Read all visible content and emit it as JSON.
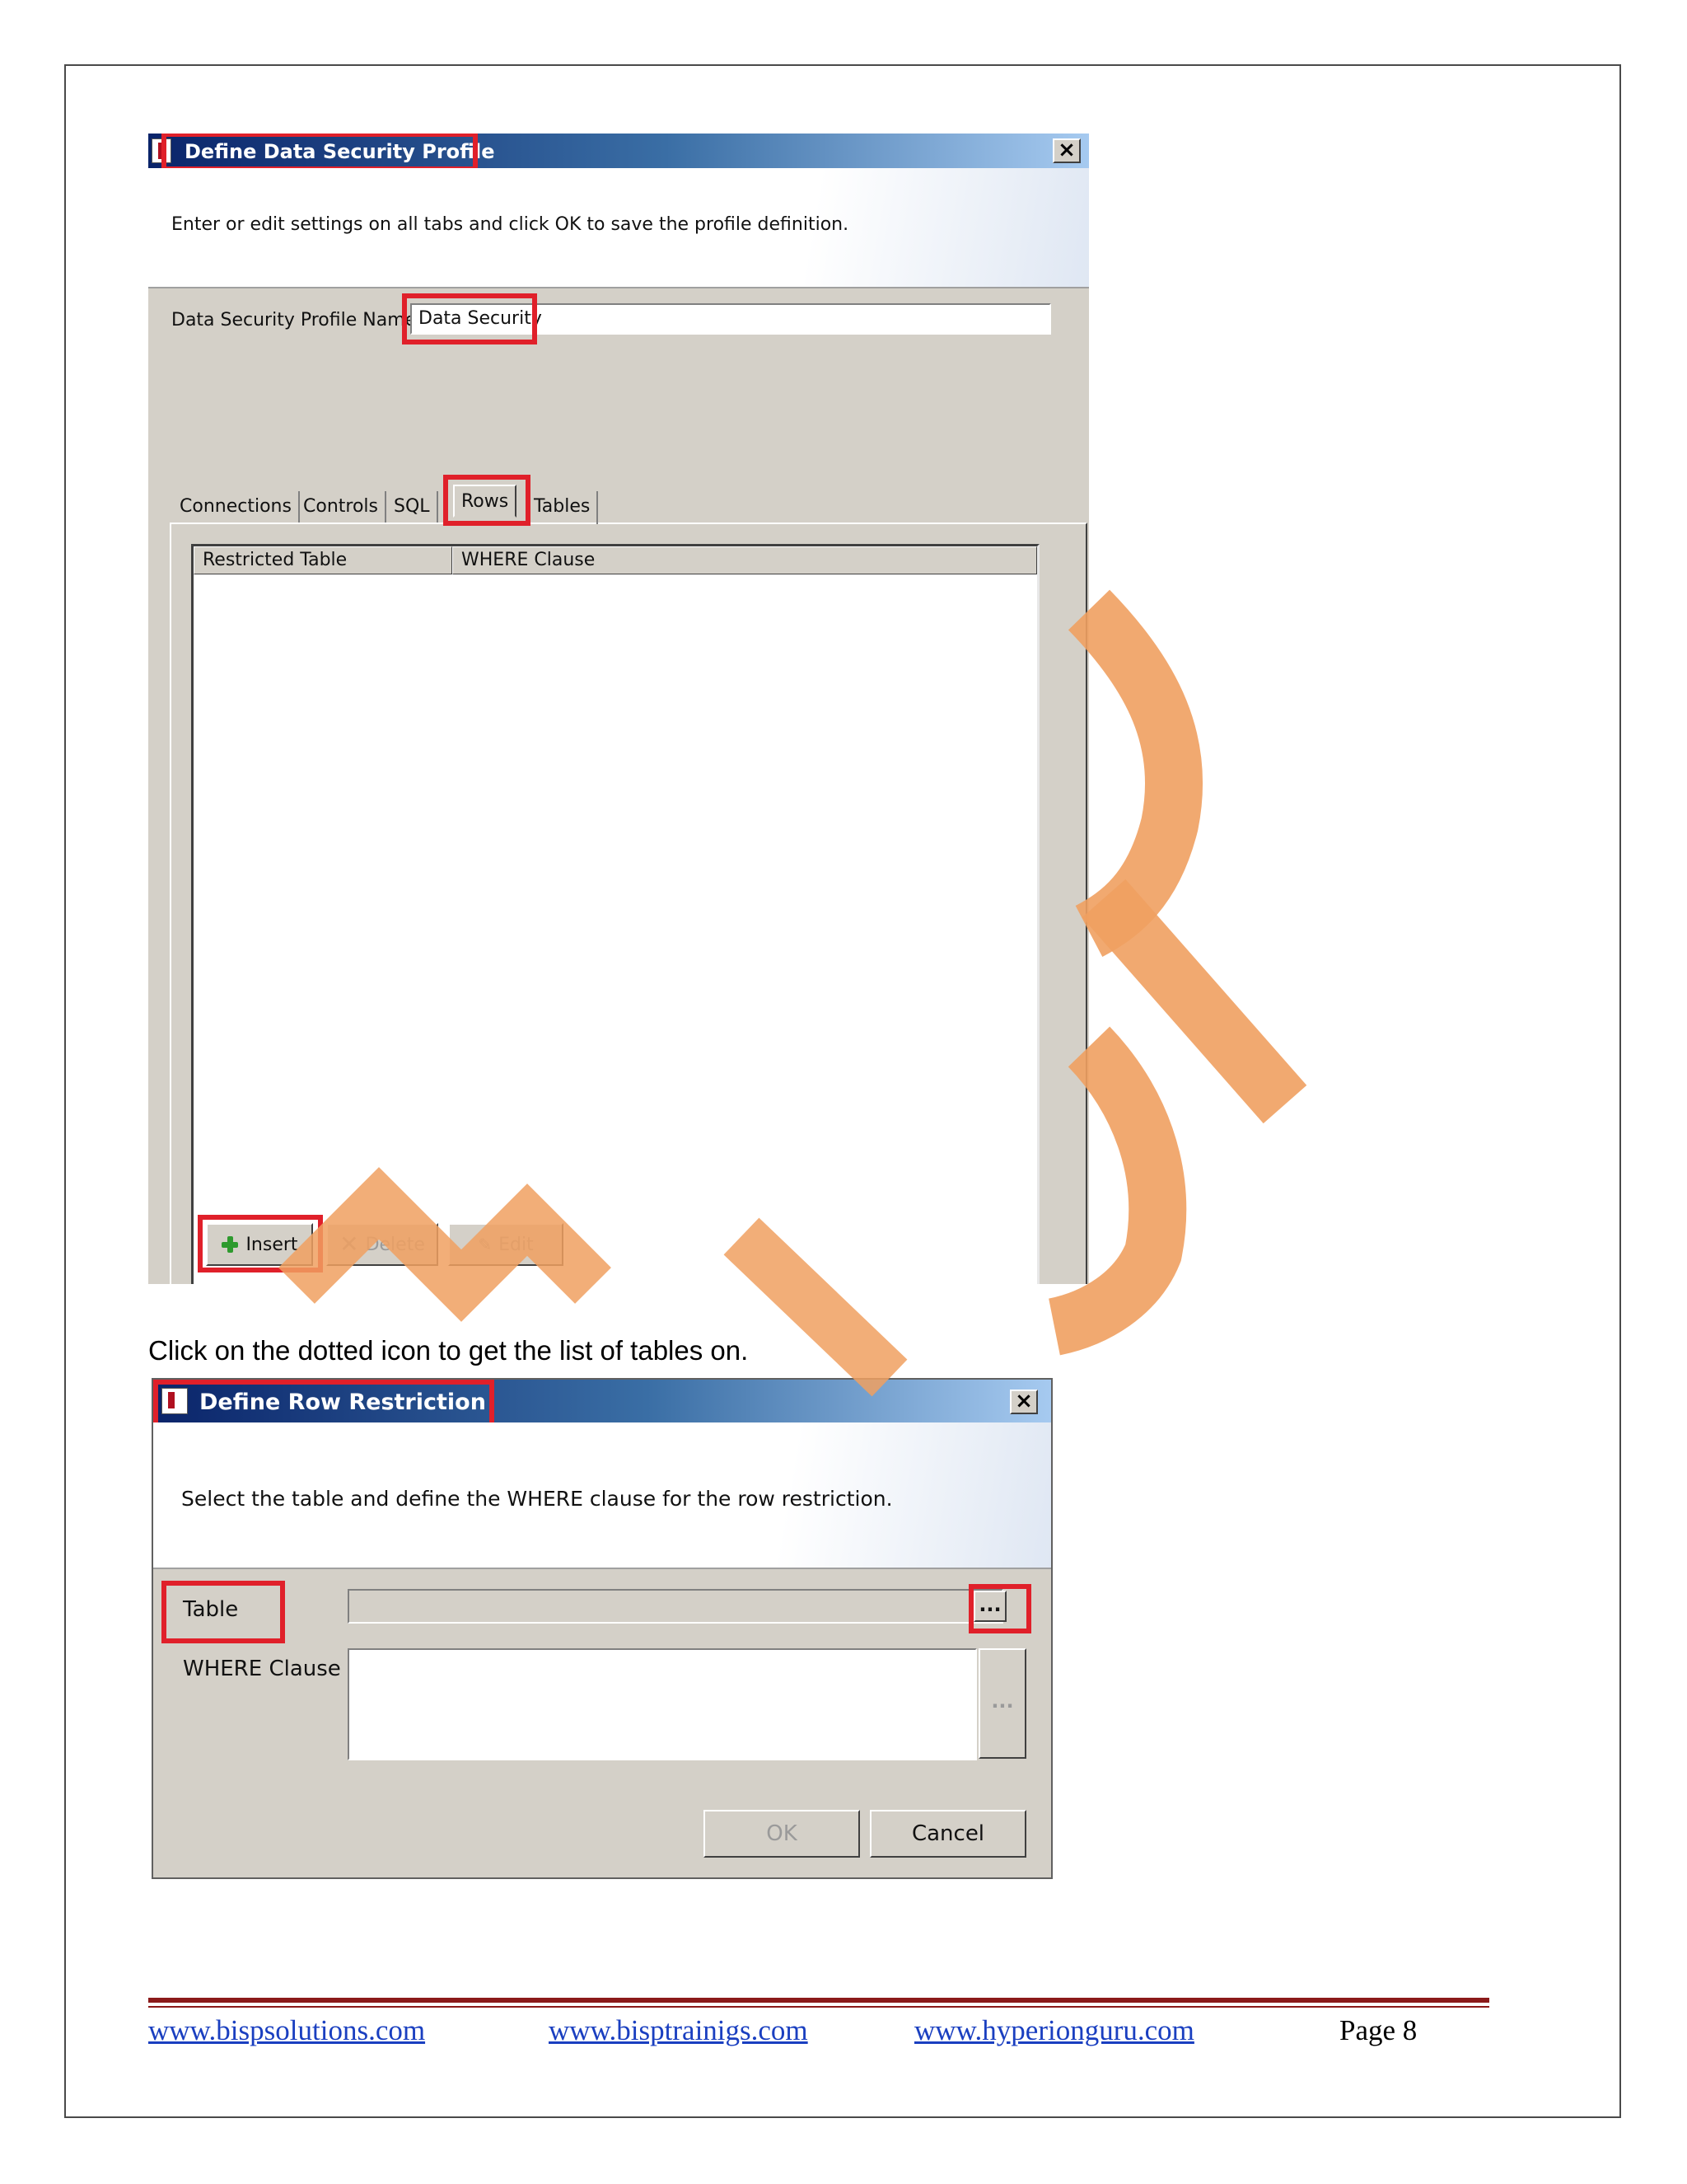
{
  "dialog1": {
    "title": "Define Data Security Profile",
    "instruction": "Enter or edit settings on all tabs and click OK to save the profile definition.",
    "close_label": "×",
    "profile_name_label": "Data Security Profile Name",
    "profile_name_value": "Data Security",
    "tabs": [
      {
        "label": "Connections"
      },
      {
        "label": "Controls"
      },
      {
        "label": "SQL"
      },
      {
        "label": "Rows",
        "active": true
      },
      {
        "label": "Tables"
      }
    ],
    "columns": [
      "Restricted Table",
      "WHERE Clause"
    ],
    "buttons": {
      "insert": "Insert",
      "delete": "Delete",
      "edit": "Edit"
    }
  },
  "caption": "Click on the dotted icon to get the list of tables on.",
  "dialog2": {
    "title": "Define Row Restriction",
    "instruction": "Select the table and define the WHERE clause for the row restriction.",
    "close_label": "×",
    "table_label": "Table",
    "table_value": "",
    "where_label": "WHERE Clause",
    "where_value": "",
    "browse_label": "...",
    "ok_label": "OK",
    "cancel_label": "Cancel"
  },
  "footer": {
    "links": [
      "www.bispsolutions.com",
      "www.bisptrainigs.com",
      "www.hyperionguru.com"
    ],
    "page_label": "Page 8"
  },
  "colors": {
    "highlight": "#e0202a",
    "watermark": "#f0a060",
    "footer_rule": "#8b1a1a",
    "link": "#1a3fc0"
  }
}
